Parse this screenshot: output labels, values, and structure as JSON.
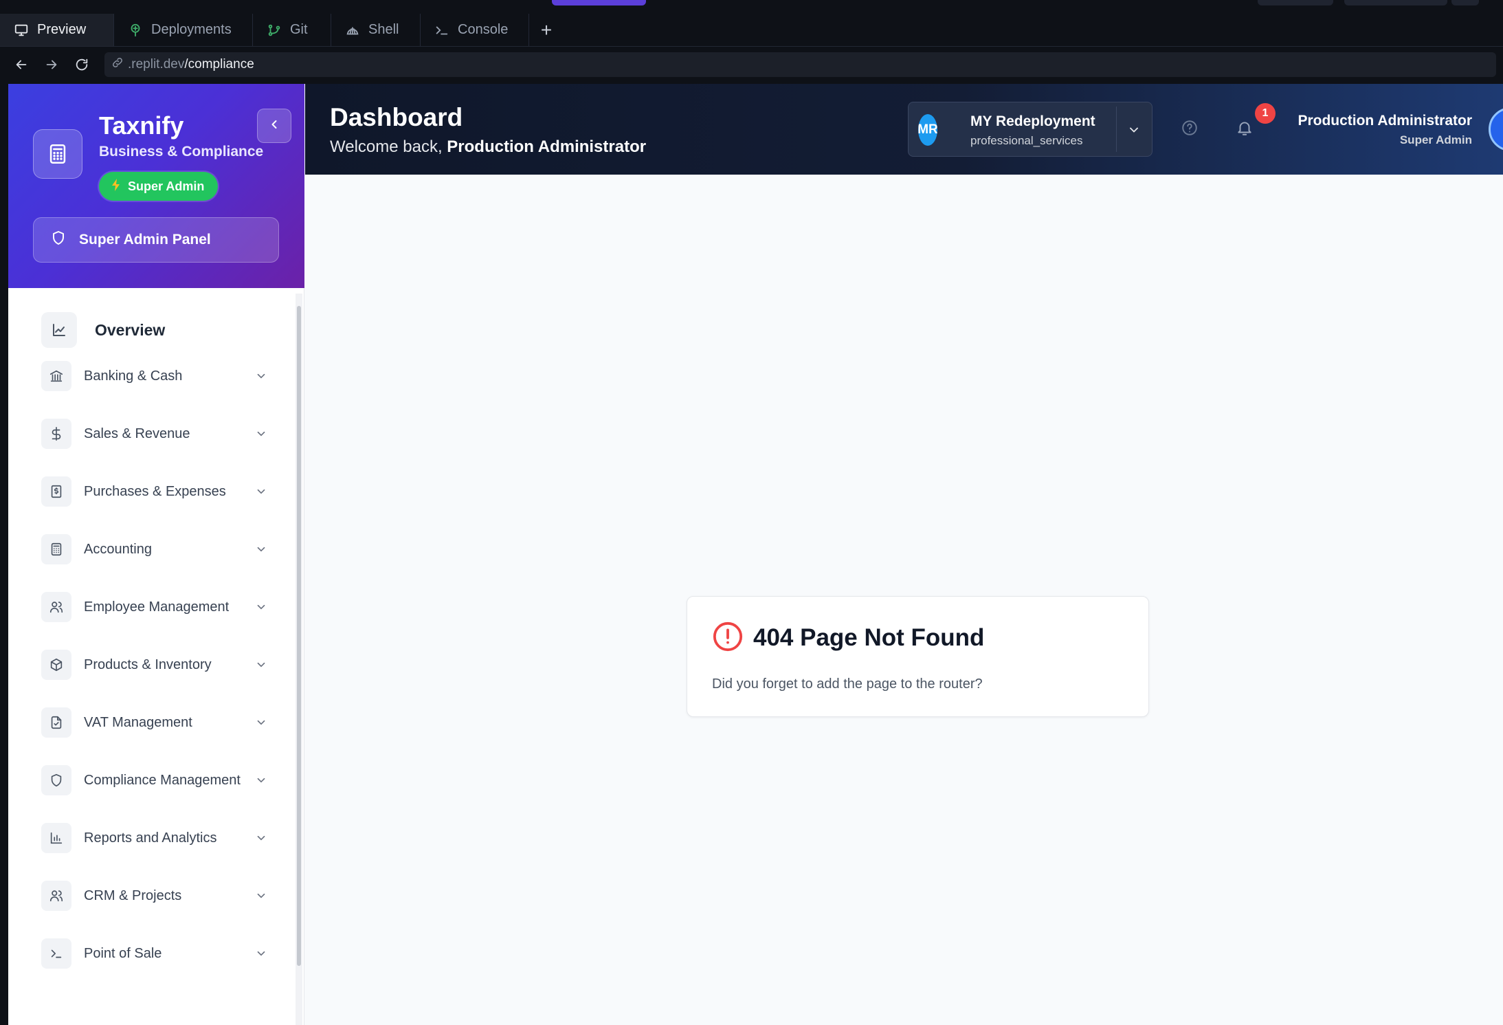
{
  "browser": {
    "tabs": [
      {
        "label": "Preview",
        "icon": "monitor-icon",
        "active": true
      },
      {
        "label": "Deployments",
        "icon": "deployments-icon",
        "active": false
      },
      {
        "label": "Git",
        "icon": "git-branch-icon",
        "active": false
      },
      {
        "label": "Shell",
        "icon": "shell-icon",
        "active": false
      },
      {
        "label": "Console",
        "icon": "terminal-icon",
        "active": false
      }
    ],
    "add_tab": "+",
    "url_host": ".replit.dev",
    "url_path": "/compliance"
  },
  "sidebar": {
    "brand_name": "Taxnify",
    "brand_sub": "Business & Compliance",
    "badge_label": "Super Admin",
    "panel_button": "Super Admin Panel",
    "overview_label": "Overview",
    "items": [
      {
        "label": "Banking & Cash",
        "icon": "bank-icon"
      },
      {
        "label": "Sales & Revenue",
        "icon": "dollar-icon"
      },
      {
        "label": "Purchases & Expenses",
        "icon": "receipt-icon"
      },
      {
        "label": "Accounting",
        "icon": "calculator-icon"
      },
      {
        "label": "Employee Management",
        "icon": "users-icon"
      },
      {
        "label": "Products & Inventory",
        "icon": "package-icon"
      },
      {
        "label": "VAT Management",
        "icon": "file-check-icon"
      },
      {
        "label": "Compliance Management",
        "icon": "shield-icon"
      },
      {
        "label": "Reports and Analytics",
        "icon": "bar-chart-icon"
      },
      {
        "label": "CRM & Projects",
        "icon": "users-icon"
      },
      {
        "label": "Point of Sale",
        "icon": "terminal-icon"
      }
    ]
  },
  "header": {
    "title": "Dashboard",
    "welcome_prefix": "Welcome back, ",
    "welcome_name": "Production Administrator",
    "company_initials": "MR",
    "company_name": "MY Redeployment",
    "company_type": "professional_services",
    "notification_count": "1",
    "user_name": "Production Administrator",
    "user_role": "Super Admin"
  },
  "main": {
    "error_title": "404 Page Not Found",
    "error_desc": "Did you forget to add the page to the router?"
  },
  "colors": {
    "accent": "#4b30d6",
    "badge_green": "#22c55e",
    "error_red": "#ef4444",
    "header_dark": "#0f172a"
  }
}
